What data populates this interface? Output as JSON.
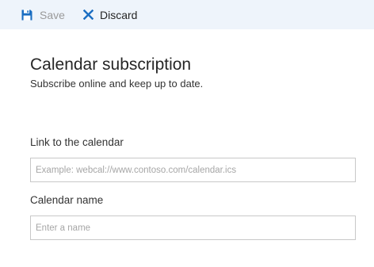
{
  "toolbar": {
    "save": {
      "label": "Save",
      "icon": "floppy-disk-icon",
      "enabled": false
    },
    "discard": {
      "label": "Discard",
      "icon": "close-x-icon"
    }
  },
  "header": {
    "title": "Calendar subscription",
    "subtitle": "Subscribe online and keep up to date."
  },
  "form": {
    "link": {
      "label": "Link to the calendar",
      "value": "",
      "placeholder": "Example: webcal://www.contoso.com/calendar.ics"
    },
    "name": {
      "label": "Calendar name",
      "value": "",
      "placeholder": "Enter a name"
    }
  },
  "colors": {
    "toolbar_bg": "#eef4fb",
    "accent": "#1b6ec2",
    "disabled_text": "#9a9a9a",
    "input_border": "#c8c8c8"
  }
}
